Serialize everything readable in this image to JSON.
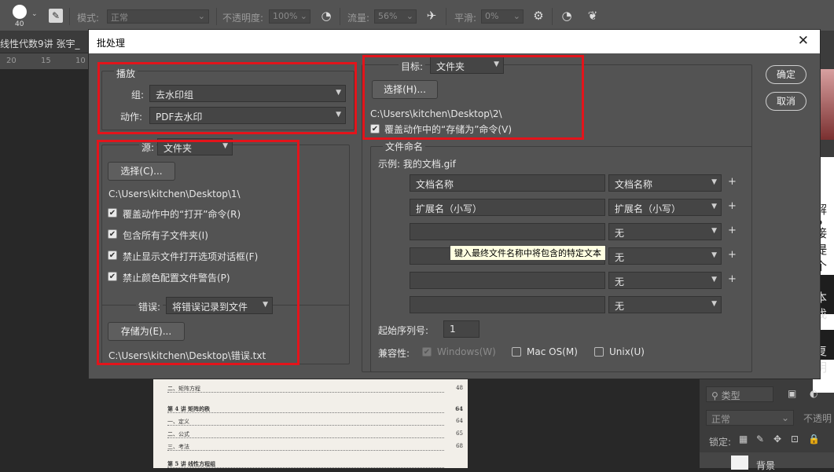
{
  "options_bar": {
    "brush_size": "40",
    "mode_label": "模式:",
    "mode_value": "正常",
    "opacity_label": "不透明度:",
    "opacity_value": "100%",
    "flow_label": "流量:",
    "flow_value": "56%",
    "smooth_label": "平滑:",
    "smooth_value": "0%"
  },
  "doc_tab": "线性代数9讲 张宇_",
  "ruler_ticks": [
    "20",
    "15",
    "10"
  ],
  "right_panel": {
    "fragments": [
      "解 P",
      "接提",
      "一个",
      "本找",
      "复明"
    ],
    "layer_filter": "类型",
    "blend_mode": "正常",
    "opacity_label": "不透明",
    "lock_label": "锁定:",
    "layer_name": "背景"
  },
  "page_lines": [
    {
      "text": "二、矩阵方程",
      "num": "48"
    },
    {
      "text": "第 4 讲    矩阵的秩",
      "num": "64"
    },
    {
      "text": "一、定义",
      "num": "64"
    },
    {
      "text": "二、公式",
      "num": "65"
    },
    {
      "text": "三、考法",
      "num": "68"
    },
    {
      "text": "第 5 讲    线性方程组",
      "num": ""
    }
  ],
  "dialog": {
    "title": "批处理",
    "close": "✕",
    "ok": "确定",
    "cancel": "取消",
    "play": {
      "legend": "播放",
      "group_label": "组:",
      "group_value": "去水印组",
      "action_label": "动作:",
      "action_value": "PDF去水印"
    },
    "source": {
      "label": "源:",
      "value": "文件夹",
      "choose": "选择(C)...",
      "path": "C:\\Users\\kitchen\\Desktop\\1\\",
      "options": [
        {
          "label": "覆盖动作中的“打开”命令(R)",
          "checked": true
        },
        {
          "label": "包含所有子文件夹(I)",
          "checked": true
        },
        {
          "label": "禁止显示文件打开选项对话框(F)",
          "checked": true
        },
        {
          "label": "禁止颜色配置文件警告(P)",
          "checked": true
        }
      ]
    },
    "errors": {
      "label": "错误:",
      "value": "将错误记录到文件",
      "save_as": "存储为(E)...",
      "path": "C:\\Users\\kitchen\\Desktop\\错误.txt"
    },
    "dest": {
      "label": "目标:",
      "value": "文件夹",
      "choose": "选择(H)...",
      "path": "C:\\Users\\kitchen\\Desktop\\2\\",
      "override": "覆盖动作中的“存储为”命令(V)"
    },
    "naming": {
      "legend": "文件命名",
      "example": "示例: 我的文档.gif",
      "rows": [
        {
          "text": "文档名称",
          "select": "文档名称",
          "plus": true
        },
        {
          "text": "扩展名（小写）",
          "select": "扩展名（小写）",
          "plus": true
        },
        {
          "text": "",
          "select": "无",
          "plus": true
        },
        {
          "text": "",
          "select": "无",
          "plus": true
        },
        {
          "text": "",
          "select": "无",
          "plus": true
        },
        {
          "text": "",
          "select": "无",
          "plus": false
        }
      ],
      "tooltip": "键入最终文件名称中将包含的特定文本",
      "start_serial_label": "起始序列号:",
      "start_serial_value": "1",
      "compat_label": "兼容性:",
      "compat": [
        {
          "label": "Windows(W)",
          "checked": true,
          "disabled": true
        },
        {
          "label": "Mac OS(M)",
          "checked": false,
          "disabled": false
        },
        {
          "label": "Unix(U)",
          "checked": false,
          "disabled": false
        }
      ]
    }
  },
  "colors": {
    "highlight": "#e3141b",
    "dialog_bg": "#535353"
  }
}
